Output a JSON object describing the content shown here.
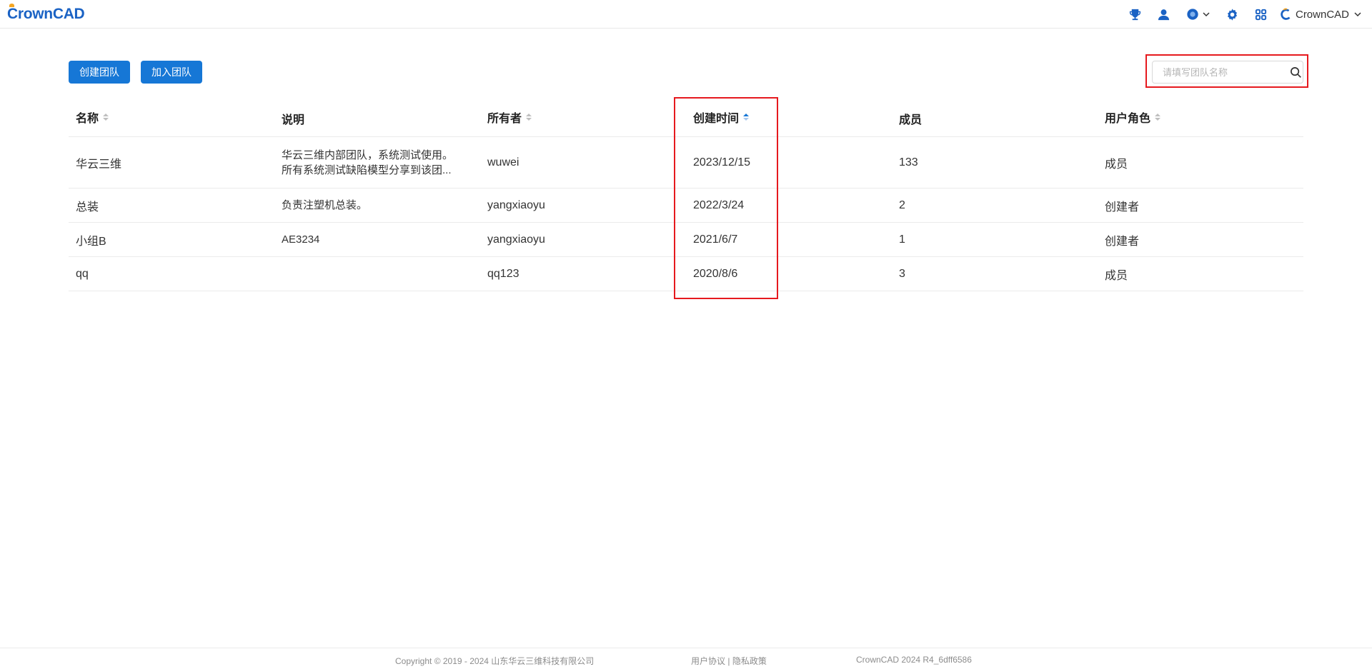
{
  "header": {
    "logo_text": "CrownCAD",
    "account_name": "CrownCAD",
    "icons": [
      "trophy-icon",
      "user-icon",
      "help-icon",
      "settings-icon",
      "apps-icon"
    ],
    "accent_color": "#1677d6"
  },
  "toolbar": {
    "create_team_label": "创建团队",
    "join_team_label": "加入团队",
    "search_placeholder": "请填写团队名称",
    "search_value": ""
  },
  "table": {
    "columns": [
      {
        "label": "名称",
        "sortable": true
      },
      {
        "label": "说明",
        "sortable": false
      },
      {
        "label": "所有者",
        "sortable": true
      },
      {
        "label": "创建时间",
        "sortable": true,
        "sort": "ascending"
      },
      {
        "label": "成员",
        "sortable": false
      },
      {
        "label": "用户角色",
        "sortable": true
      }
    ],
    "rows": [
      {
        "name": "华云三维",
        "desc_line1": "华云三维内部团队，系统测试使用。",
        "desc_line2": "所有系统测试缺陷模型分享到该团...",
        "owner": "wuwei",
        "created": "2023/12/15",
        "members": "133",
        "role": "成员"
      },
      {
        "name": "总装",
        "desc_line1": "负责注塑机总装。",
        "desc_line2": "",
        "owner": "yangxiaoyu",
        "created": "2022/3/24",
        "members": "2",
        "role": "创建者"
      },
      {
        "name": "小组B",
        "desc_line1": "AE3234",
        "desc_line2": "",
        "owner": "yangxiaoyu",
        "created": "2021/6/7",
        "members": "1",
        "role": "创建者"
      },
      {
        "name": "qq",
        "desc_line1": "",
        "desc_line2": "",
        "owner": "qq123",
        "created": "2020/8/6",
        "members": "3",
        "role": "成员"
      }
    ]
  },
  "footer": {
    "copyright": "Copyright © 2019 - 2024 山东华云三维科技有限公司",
    "user_agreement": "用户协议",
    "separator": "|",
    "privacy_policy": "隐私政策",
    "version": "CrownCAD 2024 R4_6dff6586"
  }
}
